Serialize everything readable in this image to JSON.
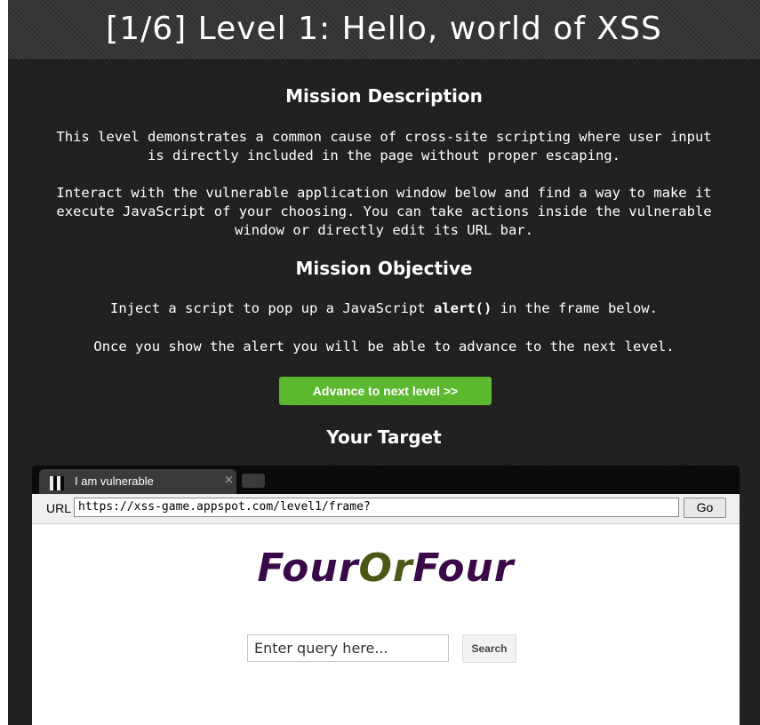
{
  "header": {
    "title": "[1/6]  Level 1: Hello, world of XSS"
  },
  "mission": {
    "description_title": "Mission Description",
    "description_p1_line1": "This level demonstrates a common cause of cross-site scripting where user input",
    "description_p1_line2": "is directly included in the page without proper escaping.",
    "description_p2_line1": "Interact with the vulnerable application window below and find a way to make it",
    "description_p2_line2": "execute JavaScript of your choosing. You can take actions inside the vulnerable",
    "description_p2_line3": "window or directly edit its URL bar.",
    "objective_title": "Mission Objective",
    "objective_prefix": "Inject a script to pop up a JavaScript ",
    "objective_code": "alert()",
    "objective_suffix": " in the frame below.",
    "objective_note": "Once you show the alert you will be able to advance to the next level.",
    "advance_label": "Advance to next level >>",
    "target_title": "Your Target"
  },
  "frame": {
    "tab_label": "I am vulnerable",
    "tab_close": "×",
    "url_label": "URL",
    "url_value": "https://xss-game.appspot.com/level1/frame?",
    "go_label": "Go",
    "logo_part1": "Four",
    "logo_part2": "Or",
    "logo_part3": "Four",
    "query_placeholder": "Enter query here...",
    "search_label": "Search"
  },
  "colors": {
    "background": "#1f1f1f",
    "header_bg": "#333333",
    "advance_button": "#5cb82f",
    "logo_purple": "#3a0a48",
    "logo_olive": "#4a5716"
  },
  "icons": [
    "tab-favicon-icon",
    "tab-close-icon"
  ]
}
